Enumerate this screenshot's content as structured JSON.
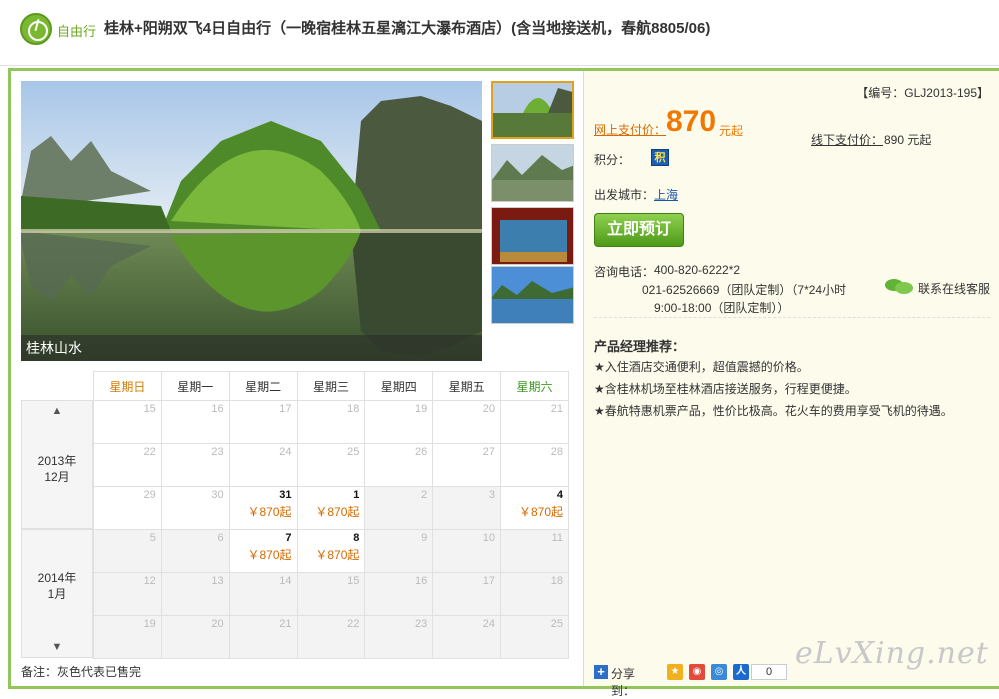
{
  "header": {
    "badge": "自由行",
    "title": "桂林+阳朔双飞4日自由行（一晚宿桂林五星漓江大瀑布酒店）(含当地接送机，春航8805/06)"
  },
  "gallery": {
    "caption": "桂林山水"
  },
  "calendar": {
    "weekdays": [
      "星期日",
      "星期一",
      "星期二",
      "星期三",
      "星期四",
      "星期五",
      "星期六"
    ],
    "months": [
      {
        "label": "2013年\n12月"
      },
      {
        "label": "2014年\n1月"
      }
    ],
    "rows": [
      [
        {
          "d": "15"
        },
        {
          "d": "16"
        },
        {
          "d": "17"
        },
        {
          "d": "18"
        },
        {
          "d": "19"
        },
        {
          "d": "20"
        },
        {
          "d": "21"
        }
      ],
      [
        {
          "d": "22"
        },
        {
          "d": "23"
        },
        {
          "d": "24"
        },
        {
          "d": "25"
        },
        {
          "d": "26"
        },
        {
          "d": "27"
        },
        {
          "d": "28"
        }
      ],
      [
        {
          "d": "29"
        },
        {
          "d": "30"
        },
        {
          "d": "31",
          "p": "￥870起"
        },
        {
          "d": "1",
          "p": "￥870起"
        },
        {
          "d": "2",
          "g": 1
        },
        {
          "d": "3",
          "g": 1
        },
        {
          "d": "4",
          "p": "￥870起"
        }
      ],
      [
        {
          "d": "5",
          "g": 1
        },
        {
          "d": "6",
          "g": 1
        },
        {
          "d": "7",
          "p": "￥870起"
        },
        {
          "d": "8",
          "p": "￥870起"
        },
        {
          "d": "9",
          "g": 1
        },
        {
          "d": "10",
          "g": 1
        },
        {
          "d": "11",
          "g": 1
        }
      ],
      [
        {
          "d": "12",
          "g": 1
        },
        {
          "d": "13",
          "g": 1
        },
        {
          "d": "14",
          "g": 1
        },
        {
          "d": "15",
          "g": 1
        },
        {
          "d": "16",
          "g": 1
        },
        {
          "d": "17",
          "g": 1
        },
        {
          "d": "18",
          "g": 1
        }
      ],
      [
        {
          "d": "19",
          "g": 1
        },
        {
          "d": "20",
          "g": 1
        },
        {
          "d": "21",
          "g": 1
        },
        {
          "d": "22",
          "g": 1
        },
        {
          "d": "23",
          "g": 1
        },
        {
          "d": "24",
          "g": 1
        },
        {
          "d": "25",
          "g": 1
        }
      ]
    ],
    "note": "备注：灰色代表已售完"
  },
  "product": {
    "code": "【编号：GLJ2013-195】",
    "online_label": "网上支付价：",
    "online_price": "870",
    "online_unit": "元起",
    "offline_label": "线下支付价：",
    "offline_value": "890 元起",
    "points_label": "积分：",
    "points_icon": "积",
    "city_label": "出发城市：",
    "city": "上海",
    "book_button": "立即预订",
    "tel_label": "咨询电话：",
    "tel_1": "400-820-6222*2",
    "tel_2": "021-62526669（团队定制）（7*24小时",
    "tel_3": "9:00-18:00（团队定制））",
    "cs_label": "联系在线客服",
    "rec_title": "产品经理推荐：",
    "rec_items": [
      "★入住酒店交通便利，超值震撼的价格。",
      "★含桂林机场至桂林酒店接送服务，行程更便捷。",
      "★春航特惠机票产品，性价比极高。花火车的费用享受飞机的待遇。"
    ],
    "share_label": "分享到：",
    "share_count": "0"
  },
  "watermark": "eLvXing.net"
}
